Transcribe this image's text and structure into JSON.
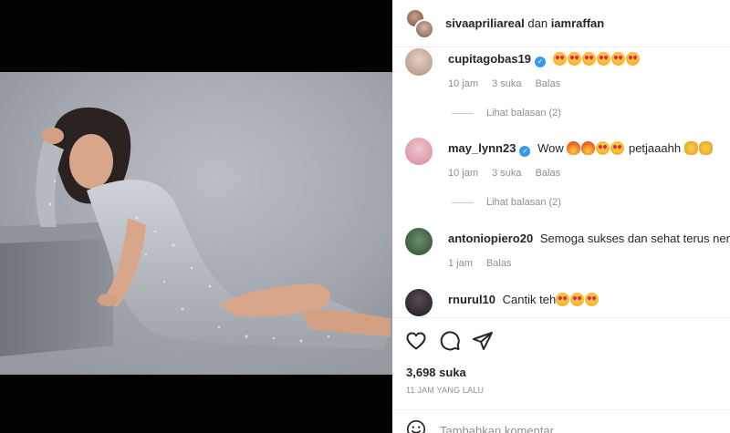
{
  "header": {
    "user1": "sivaapriliareal",
    "joiner": "dan",
    "user2": "iamraffan"
  },
  "comments": [
    {
      "username": "cupitagobas19",
      "verified": true,
      "text_prefix": "",
      "emojis": [
        "heart-eyes",
        "heart-eyes",
        "heart-eyes",
        "heart-eyes",
        "heart-eyes",
        "heart-eyes"
      ],
      "time": "10 jam",
      "likes": "3 suka",
      "reply": "Balas",
      "view_replies": "Lihat balasan (2)"
    },
    {
      "username": "may_lynn23",
      "verified": true,
      "text_prefix": "Wow",
      "text_suffix": "petjaaahh",
      "time": "10 jam",
      "likes": "3 suka",
      "reply": "Balas",
      "view_replies": "Lihat balasan (2)"
    },
    {
      "username": "antoniopiero20",
      "verified": false,
      "text_prefix": "Semoga sukses dan sehat terus neng si",
      "time": "1 jam",
      "reply": "Balas"
    },
    {
      "username": "rnurul10",
      "verified": false,
      "text_prefix": "Cantik teh"
    }
  ],
  "post": {
    "likes": "3,698 suka",
    "posted": "11 JAM YANG LALU",
    "comment_placeholder": "Tambahkan komentar..."
  },
  "icons": [
    "heart-icon",
    "comment-icon",
    "share-icon",
    "emoji-icon",
    "verified-icon"
  ],
  "colors": {
    "verified": "#3897f0",
    "muted": "#8e8e8e",
    "text": "#262626"
  }
}
